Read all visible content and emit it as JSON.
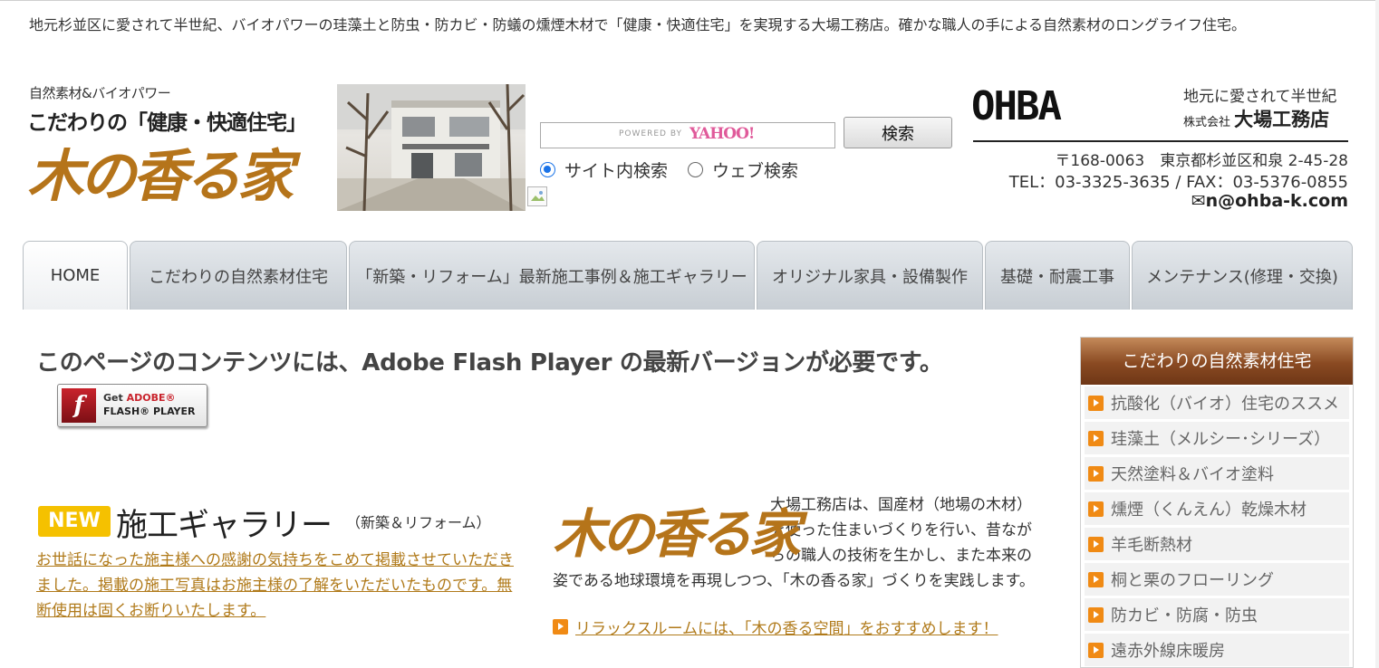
{
  "intro_text": "地元杉並区に愛されて半世紀、バイオパワーの珪藻土と防虫・防カビ・防蟻の燻煙木材で「健康・快適住宅」を実現する大場工務店。確かな職人の手による自然素材のロングライフ住宅。",
  "header": {
    "logo_sub1": "自然素材&バイオパワー",
    "logo_sub2": "こだわりの「健康・快適住宅」",
    "logo_main": "木の香る家"
  },
  "search": {
    "powered_by": "POWERED BY",
    "provider": "YAHOO!",
    "button_label": "検索",
    "options": [
      "サイト内検索",
      "ウェブ検索"
    ],
    "selected": "サイト内検索"
  },
  "company": {
    "logo": "OHBA",
    "tagline": "地元に愛されて半世紀",
    "prefix": "株式会社",
    "name": "大場工務店",
    "address": "〒168-0063　東京都杉並区和泉 2-45-28",
    "telfax": "TEL：03-3325-3635 / FAX：03-5376-0855",
    "email": "✉n@ohba-k.com"
  },
  "nav": {
    "tabs": [
      {
        "label": "HOME"
      },
      {
        "label": "こだわりの自然素材住宅"
      },
      {
        "label": "「新築・リフォーム」最新施工事例＆施工ギャラリー"
      },
      {
        "label": "オリジナル家具・設備製作"
      },
      {
        "label": "基礎・耐震工事"
      },
      {
        "label": "メンテナンス(修理・交換)"
      }
    ],
    "active": "HOME"
  },
  "flash": {
    "message": "このページのコンテンツには、Adobe Flash Player の最新バージョンが必要です。",
    "button_line1_prefix": "Get ",
    "button_line1_brand": "ADOBE®",
    "button_line2": "FLASH® PLAYER"
  },
  "gallery": {
    "badge": "NEW",
    "title": "施工ギャラリー",
    "subtitle": "（新築＆リフォーム）",
    "description": "お世話になった施主様への感謝の気持ちをこめて掲載させていただきました。掲載の施工写真はお施主様の了解をいただいたものです。無断使用は固くお断りいたします。"
  },
  "kino": {
    "logo": "木の香る家",
    "text": "大場工務店は、国産材（地場の木材）を使った住まいづくりを行い、昔ながらの職人の技術を生かし、また本来の姿である地球環境を再現しつつ、「木の香る家」づくりを実践します。",
    "link": "リラックスルームには、「木の香る空間」をおすすめします！"
  },
  "sidebar": {
    "heading": "こだわりの自然素材住宅",
    "items": [
      "抗酸化（バイオ）住宅のススメ",
      "珪藻土（メルシー･シリーズ）",
      "天然塗料＆バイオ塗料",
      "燻煙（くんえん）乾燥木材",
      "羊毛断熱材",
      "桐と栗のフローリング",
      "防カビ・防腐・防虫",
      "遠赤外線床暖房"
    ]
  },
  "colors": {
    "accent_brown": "#b5741a",
    "link_gold": "#b07a1a",
    "arrow_orange": "#f08a14",
    "badge_yellow": "#f5c100"
  }
}
